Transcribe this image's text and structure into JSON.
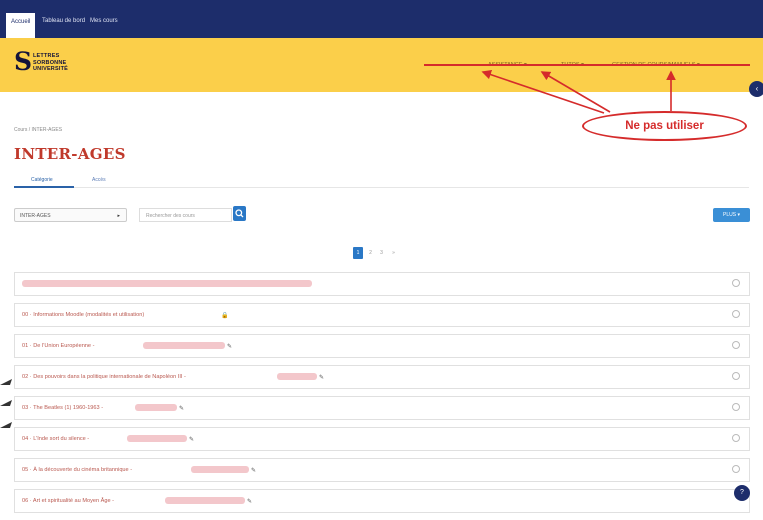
{
  "topbar": {
    "tabs": [
      {
        "label": "Accueil",
        "active": true
      },
      {
        "label": "Tableau de bord",
        "active": false
      },
      {
        "label": "Mes cours",
        "active": false
      }
    ]
  },
  "header": {
    "logo": {
      "lines": [
        "LETTRES",
        "SORBONNE",
        "UNIVERSITÉ"
      ]
    },
    "menu": [
      {
        "label": "ASSISTANCE ▾"
      },
      {
        "label": "TUTOS ▾"
      },
      {
        "label": "GESTION DE COURS/MANUELS ▾"
      }
    ]
  },
  "annotation": {
    "text": "Ne pas utiliser",
    "color": "#d52b2b"
  },
  "breadcrumb": "Cours / INTER-AGES",
  "page_title": "INTER-AGES",
  "tabs": [
    {
      "label": "Catégorie",
      "active": true
    },
    {
      "label": "Accès",
      "active": false
    }
  ],
  "filter": {
    "category_value": "INTER-AGES",
    "search_placeholder": "Rechercher des cours",
    "plus_label": "PLUS ▾"
  },
  "pagination": {
    "pages": [
      "1",
      "2",
      "3",
      "»"
    ],
    "current": "1"
  },
  "courses": [
    {
      "label": "",
      "tool": ""
    },
    {
      "label": "00 · Informations Moodle (modalités et utilisation)",
      "tool": "🔒"
    },
    {
      "label": "01 · De l’Union Européenne -",
      "tool": "✎"
    },
    {
      "label": "02 · Des pouvoirs dans la politique internationale de Napoléon III -",
      "tool": "✎"
    },
    {
      "label": "03 · The Beatles (1) 1960-1963 -",
      "tool": "✎"
    },
    {
      "label": "04 · L’Inde sort du silence -",
      "tool": "✎"
    },
    {
      "label": "05 · À la découverte du cinéma britannique -",
      "tool": "✎"
    },
    {
      "label": "06 · Art et spiritualité au Moyen Âge -",
      "tool": "✎"
    }
  ],
  "colors": {
    "topbar": "#1d2d6b",
    "header": "#fbcf4a",
    "accent": "#2a78c6",
    "title": "#c0392b",
    "annotation": "#d52b2b"
  }
}
